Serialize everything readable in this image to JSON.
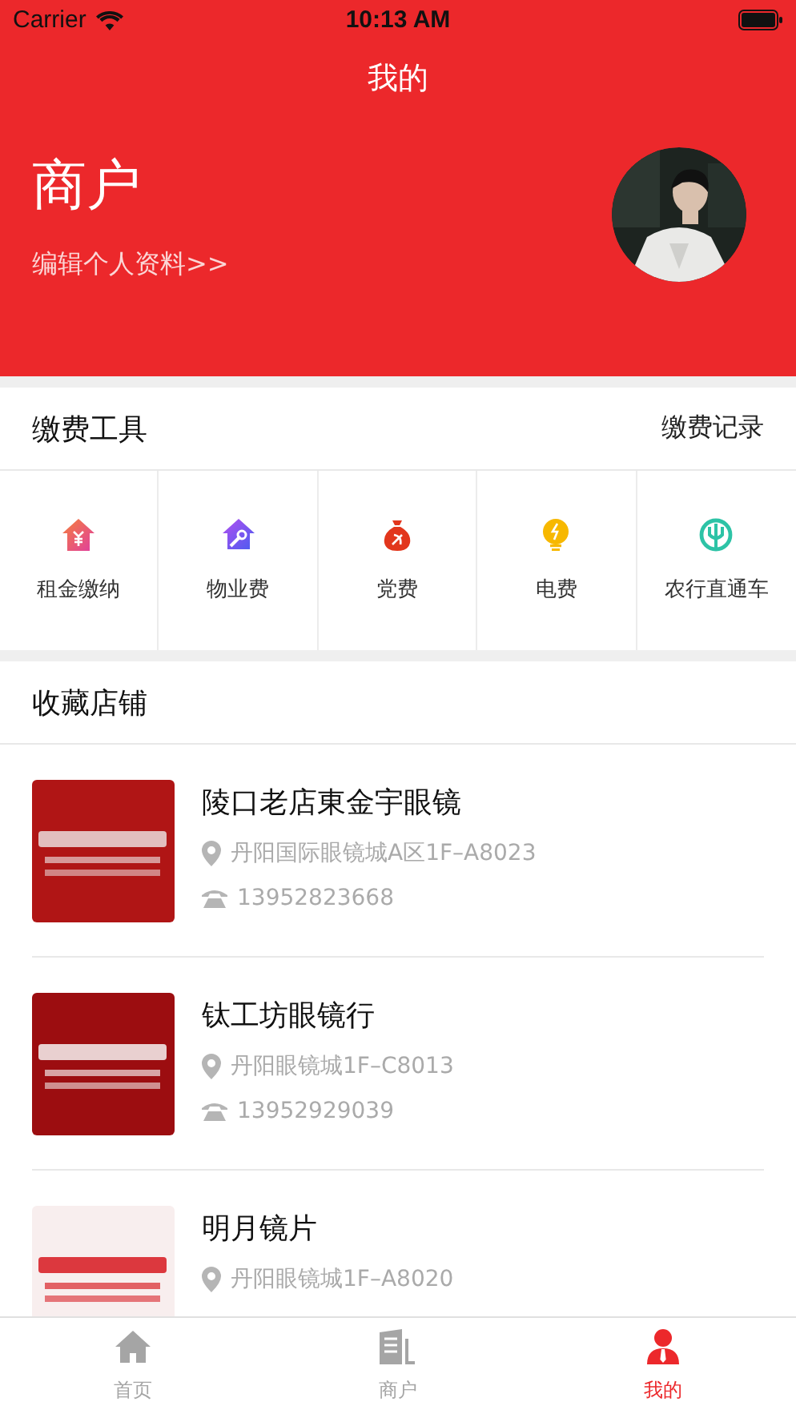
{
  "status_bar": {
    "carrier": "Carrier",
    "time": "10:13 AM"
  },
  "nav": {
    "title": "我的"
  },
  "profile": {
    "name": "商户",
    "edit_link": "编辑个人资料>>"
  },
  "payment_tools": {
    "title": "缴费工具",
    "records_link": "缴费记录",
    "items": [
      {
        "label": "租金缴纳",
        "kind": "rent"
      },
      {
        "label": "物业费",
        "kind": "property"
      },
      {
        "label": "党费",
        "kind": "party"
      },
      {
        "label": "电费",
        "kind": "electric"
      },
      {
        "label": "农行直通车",
        "kind": "bank"
      }
    ]
  },
  "favorite_stores": {
    "title": "收藏店铺",
    "stores": [
      {
        "name": "陵口老店東金宇眼镜",
        "address": "丹阳国际眼镜城A区1F–A8023",
        "phone": "13952823668"
      },
      {
        "name": "钛工坊眼镜行",
        "address": "丹阳眼镜城1F–C8013",
        "phone": "13952929039"
      },
      {
        "name": "明月镜片",
        "address": "丹阳眼镜城1F–A8020"
      }
    ]
  },
  "tab_bar": [
    {
      "label": "首页",
      "kind": "home",
      "selected": false
    },
    {
      "label": "商户",
      "kind": "building",
      "selected": false
    },
    {
      "label": "我的",
      "kind": "person",
      "selected": true
    }
  ]
}
